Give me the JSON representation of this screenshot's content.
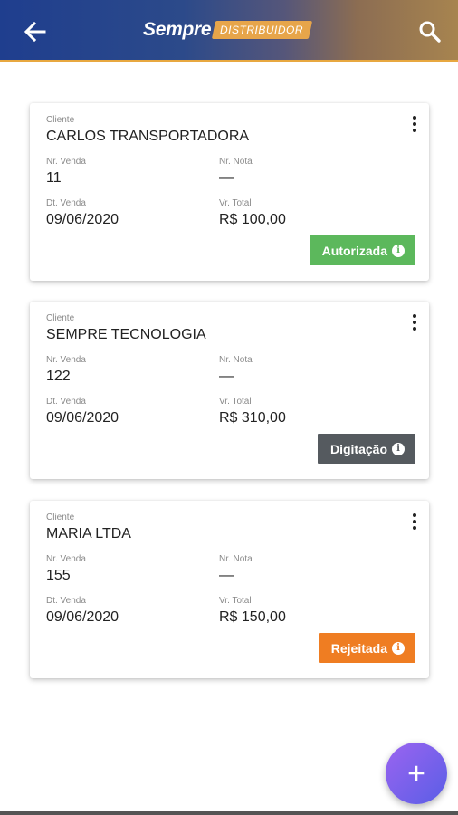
{
  "header": {
    "brand_main": "Sempre",
    "brand_tag": "DISTRIBUIDOR",
    "back_icon": "arrow-left-icon",
    "search_icon": "search-icon"
  },
  "labels": {
    "cliente": "Cliente",
    "nr_venda": "Nr. Venda",
    "nr_nota": "Nr. Nota",
    "dt_venda": "Dt. Venda",
    "vr_total": "Vr. Total"
  },
  "orders": [
    {
      "cliente": "CARLOS TRANSPORTADORA",
      "nr_venda": "11",
      "nr_nota": "—",
      "dt_venda": "09/06/2020",
      "vr_total": "R$ 100,00",
      "status": "Autorizada",
      "status_color": "#5cb85c"
    },
    {
      "cliente": "SEMPRE TECNOLOGIA",
      "nr_venda": "122",
      "nr_nota": "—",
      "dt_venda": "09/06/2020",
      "vr_total": "R$ 310,00",
      "status": "Digitação",
      "status_color": "#555a5f"
    },
    {
      "cliente": "MARIA LTDA",
      "nr_venda": "155",
      "nr_nota": "—",
      "dt_venda": "09/06/2020",
      "vr_total": "R$ 150,00",
      "status": "Rejeitada",
      "status_color": "#ef7d22"
    }
  ],
  "fab": {
    "icon": "plus-icon"
  }
}
